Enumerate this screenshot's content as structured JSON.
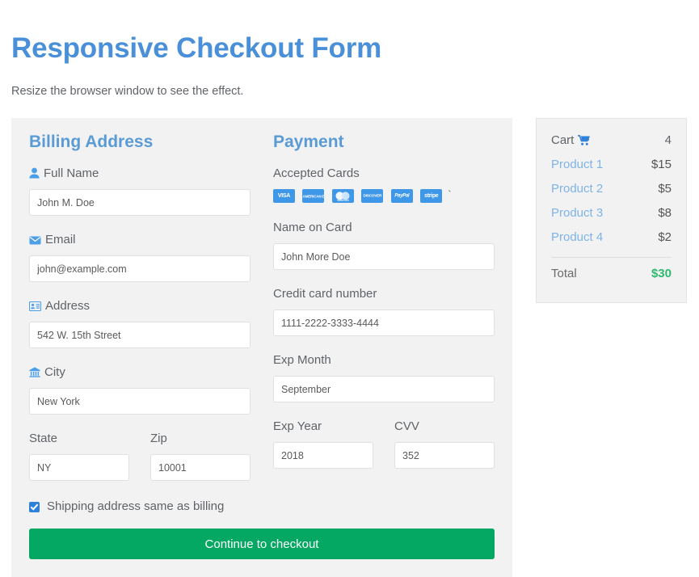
{
  "header": {
    "title": "Responsive Checkout Form",
    "subtitle": "Resize the browser window to see the effect."
  },
  "billing": {
    "heading": "Billing Address",
    "fields": {
      "full_name": {
        "label": "Full Name",
        "value": "John M. Doe",
        "icon": "user-icon"
      },
      "email": {
        "label": "Email",
        "value": "john@example.com",
        "icon": "envelope-icon"
      },
      "address": {
        "label": "Address",
        "value": "542 W. 15th Street",
        "icon": "address-card-icon"
      },
      "city": {
        "label": "City",
        "value": "New York",
        "icon": "institution-icon"
      },
      "state": {
        "label": "State",
        "value": "NY"
      },
      "zip": {
        "label": "Zip",
        "value": "10001"
      }
    },
    "checkbox_label": "Shipping address same as billing"
  },
  "payment": {
    "heading": "Payment",
    "accepted_cards_label": "Accepted Cards",
    "cards": [
      {
        "name": "visa-icon",
        "label": "VISA"
      },
      {
        "name": "amex-icon",
        "label": "AMERICAN EXPRESS"
      },
      {
        "name": "mastercard-icon",
        "label": "mastercard"
      },
      {
        "name": "discover-icon",
        "label": "DISCOVER"
      },
      {
        "name": "paypal-icon",
        "label": "PayPal"
      },
      {
        "name": "stripe-icon",
        "label": "stripe"
      }
    ],
    "stray_char": "`",
    "fields": {
      "name_on_card": {
        "label": "Name on Card",
        "value": "John More Doe"
      },
      "card_number": {
        "label": "Credit card number",
        "value": "1111-2222-3333-4444"
      },
      "exp_month": {
        "label": "Exp Month",
        "value": "September"
      },
      "exp_year": {
        "label": "Exp Year",
        "value": "2018"
      },
      "cvv": {
        "label": "CVV",
        "value": "352"
      }
    }
  },
  "submit": {
    "label": "Continue to checkout"
  },
  "cart": {
    "title": "Cart",
    "count": "4",
    "items": [
      {
        "name": "Product 1",
        "price": "$15"
      },
      {
        "name": "Product 2",
        "price": "$5"
      },
      {
        "name": "Product 3",
        "price": "$8"
      },
      {
        "name": "Product 4",
        "price": "$2"
      }
    ],
    "total_label": "Total",
    "total_value": "$30"
  },
  "colors": {
    "accent_blue": "#4a90d9",
    "heading_blue": "#5b9bd5",
    "link_blue": "#7eb3e8",
    "icon_blue": "#4a9fe8",
    "green_button": "#04a862",
    "green_total": "#2eb872",
    "panel_bg": "#f2f2f2"
  }
}
